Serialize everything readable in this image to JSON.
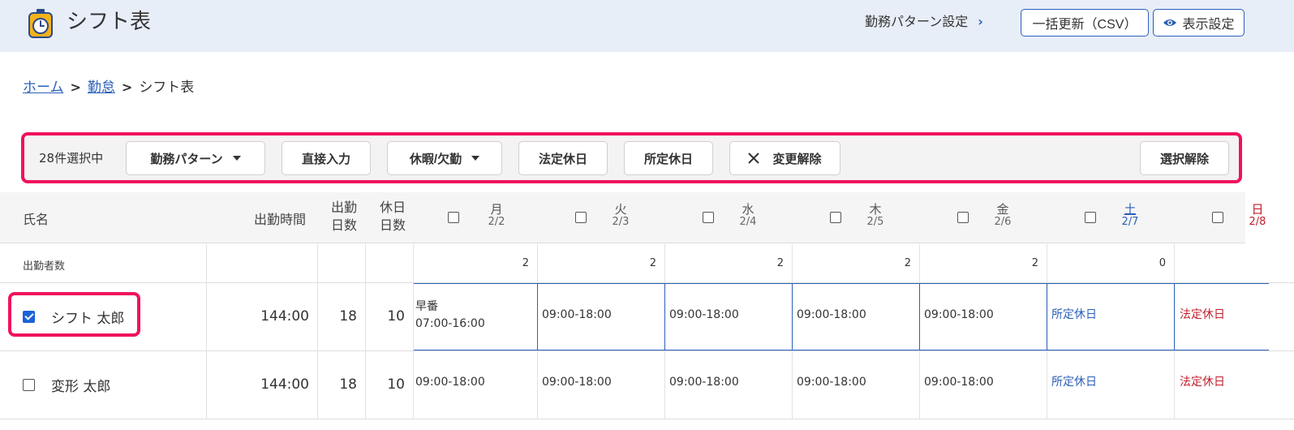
{
  "header": {
    "title": "シフト表",
    "pattern_link": "勤務パターン設定",
    "csv_button": "一括更新（CSV）",
    "display_button": "表示設定"
  },
  "breadcrumb": {
    "home": "ホーム",
    "attendance": "勤怠",
    "current": "シフト表"
  },
  "action_bar": {
    "selected_count": "28件選択中",
    "work_pattern": "勤務パターン",
    "direct_input": "直接入力",
    "leave": "休暇/欠勤",
    "legal_holiday": "法定休日",
    "scheduled_holiday": "所定休日",
    "clear_changes": "変更解除",
    "deselect": "選択解除"
  },
  "table": {
    "col_name": "氏名",
    "col_hours": "出勤時間",
    "col_workdays_1": "出勤",
    "col_workdays_2": "日数",
    "col_holidays_1": "休日",
    "col_holidays_2": "日数",
    "days": [
      {
        "weekday": "月",
        "date": "2/2",
        "type": "weekday"
      },
      {
        "weekday": "火",
        "date": "2/3",
        "type": "weekday"
      },
      {
        "weekday": "水",
        "date": "2/4",
        "type": "weekday"
      },
      {
        "weekday": "木",
        "date": "2/5",
        "type": "weekday"
      },
      {
        "weekday": "金",
        "date": "2/6",
        "type": "weekday"
      },
      {
        "weekday": "土",
        "date": "2/7",
        "type": "sat"
      },
      {
        "weekday": "日",
        "date": "2/8",
        "type": "sun"
      }
    ],
    "attendee_label": "出勤者数",
    "attendee_counts": [
      "2",
      "2",
      "2",
      "2",
      "2",
      "0"
    ],
    "employees": [
      {
        "name": "シフト 太郎",
        "checked": true,
        "hours": "144:00",
        "workdays": "18",
        "holidays": "10",
        "shifts": [
          {
            "line1": "早番",
            "line2": "07:00-16:00",
            "type": "weekday"
          },
          {
            "line1": "09:00-18:00",
            "line2": "",
            "type": "weekday"
          },
          {
            "line1": "09:00-18:00",
            "line2": "",
            "type": "weekday"
          },
          {
            "line1": "09:00-18:00",
            "line2": "",
            "type": "weekday"
          },
          {
            "line1": "09:00-18:00",
            "line2": "",
            "type": "weekday"
          },
          {
            "line1": "所定休日",
            "line2": "",
            "type": "sat"
          },
          {
            "line1": "法定休日",
            "line2": "",
            "type": "sun"
          }
        ]
      },
      {
        "name": "変形 太郎",
        "checked": false,
        "hours": "144:00",
        "workdays": "18",
        "holidays": "10",
        "shifts": [
          {
            "line1": "09:00-18:00",
            "line2": "",
            "type": "weekday"
          },
          {
            "line1": "09:00-18:00",
            "line2": "",
            "type": "weekday"
          },
          {
            "line1": "09:00-18:00",
            "line2": "",
            "type": "weekday"
          },
          {
            "line1": "09:00-18:00",
            "line2": "",
            "type": "weekday"
          },
          {
            "line1": "09:00-18:00",
            "line2": "",
            "type": "weekday"
          },
          {
            "line1": "所定休日",
            "line2": "",
            "type": "sat"
          },
          {
            "line1": "法定休日",
            "line2": "",
            "type": "sun"
          }
        ]
      }
    ]
  },
  "colors": {
    "accent": "#2b5fb8",
    "highlight": "#f0125c",
    "sunday": "#c0202e",
    "header_bg": "#e8eef8"
  }
}
